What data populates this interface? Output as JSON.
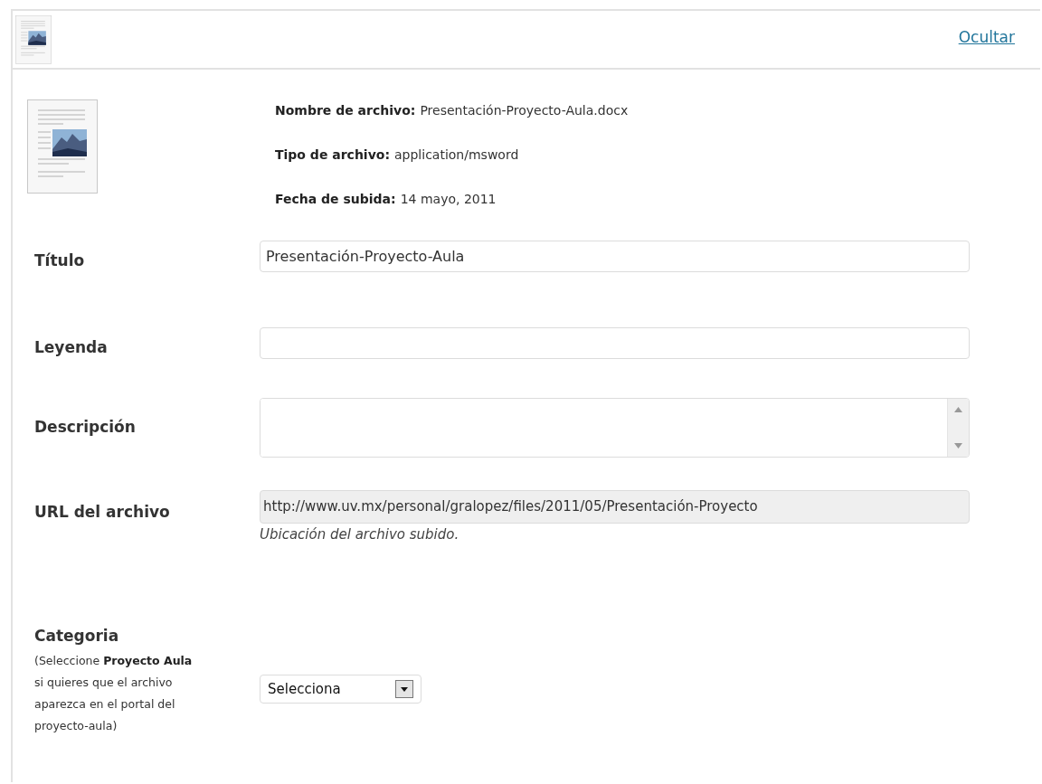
{
  "header": {
    "link": "Ocultar"
  },
  "file_info": [
    {
      "label": "Nombre de archivo:",
      "value": "Presentación-Proyecto-Aula.docx"
    },
    {
      "label": "Tipo de archivo:",
      "value": "application/msword"
    },
    {
      "label": "Fecha de subida:",
      "value": "14 mayo, 2011"
    }
  ],
  "fields": [
    {
      "kind": "text",
      "label": "Título",
      "value": "Presentación-Proyecto-Aula"
    },
    {
      "kind": "text",
      "label": "Leyenda"
    },
    {
      "kind": "textarea",
      "label": "Descripción"
    },
    {
      "kind": "readonly",
      "label": "URL del archivo",
      "value": "http://www.uv.mx/personal/gralopez/files/2011/05/Presentación-Proyecto",
      "hint": "Ubicación del archivo subido."
    }
  ],
  "category": {
    "label": "Categoria",
    "help": "(Seleccione **Proyecto Aula** si quieres que el archivo aparezca en el portal del proyecto-aula)",
    "select": "Selecciona"
  }
}
